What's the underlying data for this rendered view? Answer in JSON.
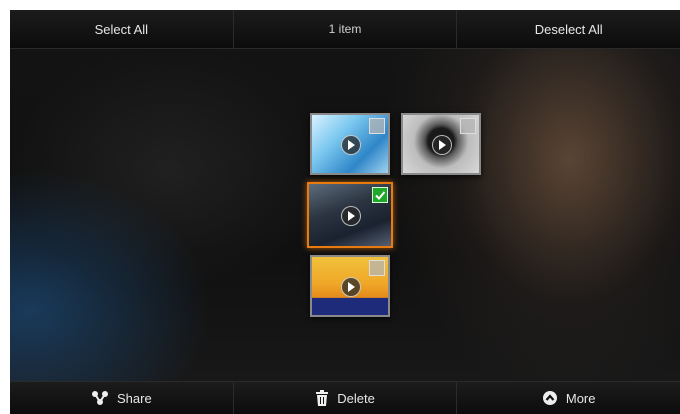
{
  "top_bar": {
    "select_all_label": "Select All",
    "item_count": "1 item",
    "deselect_all_label": "Deselect All"
  },
  "thumbnails": [
    {
      "selected": false
    },
    {
      "selected": false
    },
    {
      "selected": true
    },
    {
      "selected": false
    }
  ],
  "bottom_bar": {
    "share_label": "Share",
    "delete_label": "Delete",
    "more_label": "More"
  },
  "colors": {
    "selection_border": "#e87a10",
    "check_selected": "#1fa82a"
  }
}
